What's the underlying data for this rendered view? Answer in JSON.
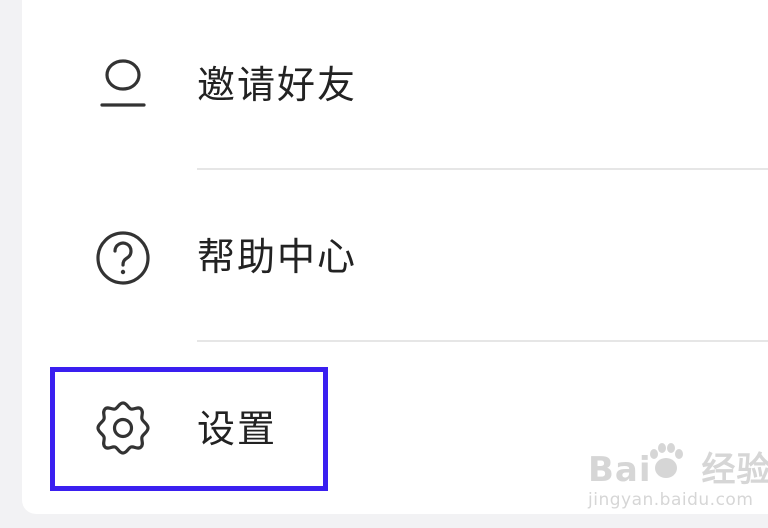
{
  "menu": {
    "items": [
      {
        "label": "邀请好友",
        "icon": "person-icon"
      },
      {
        "label": "帮助中心",
        "icon": "question-circle-icon"
      },
      {
        "label": "设置",
        "icon": "gear-icon"
      }
    ]
  },
  "highlight": {
    "color": "#3a1ff0"
  },
  "watermark": {
    "logo_left": "Bai",
    "logo_right": "经验",
    "sub": "jingyan.baidu.com"
  }
}
